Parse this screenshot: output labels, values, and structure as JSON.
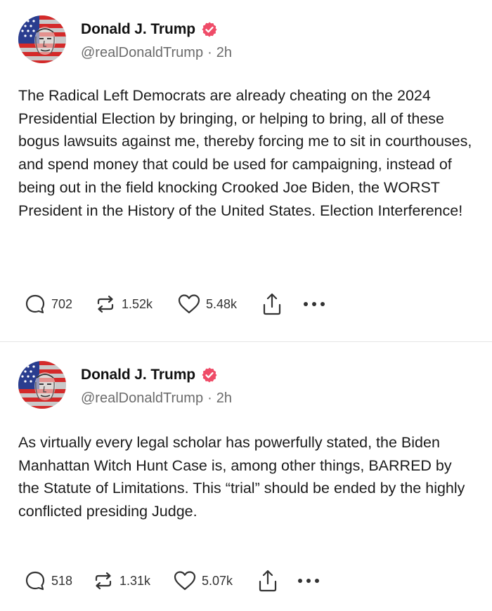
{
  "colors": {
    "verified_badge": "#ef4c68",
    "handle_gray": "#6b6b6b",
    "divider": "#e6e6e6"
  },
  "posts": [
    {
      "author": {
        "name": "Donald J. Trump",
        "handle": "@realDonaldTrump",
        "time": "2h",
        "separator": "·",
        "avatar_icon": "flag-portrait-avatar",
        "verified_icon": "verified-badge-icon"
      },
      "text": "The Radical Left Democrats are already cheating on the 2024 Presidential Election by bringing, or helping to bring, all of these bogus lawsuits against me, thereby forcing me to sit in courthouses, and spend money that could be used for campaigning, instead of being out in the field knocking Crooked Joe Biden, the WORST President in the History of the United States. Election Interference!",
      "stats": {
        "replies": "702",
        "retruths": "1.52k",
        "likes": "5.48k"
      }
    },
    {
      "author": {
        "name": "Donald J. Trump",
        "handle": "@realDonaldTrump",
        "time": "2h",
        "separator": "·",
        "avatar_icon": "flag-portrait-avatar",
        "verified_icon": "verified-badge-icon"
      },
      "text": "As virtually every legal scholar has powerfully stated, the Biden Manhattan Witch Hunt Case is, among other things, BARRED by the Statute of Limitations. This “trial” should be ended by the highly conflicted presiding Judge.",
      "stats": {
        "replies": "518",
        "retruths": "1.31k",
        "likes": "5.07k"
      }
    }
  ],
  "action_icons": [
    "reply-icon",
    "retruth-icon",
    "like-heart-icon",
    "share-icon",
    "more-icon"
  ]
}
